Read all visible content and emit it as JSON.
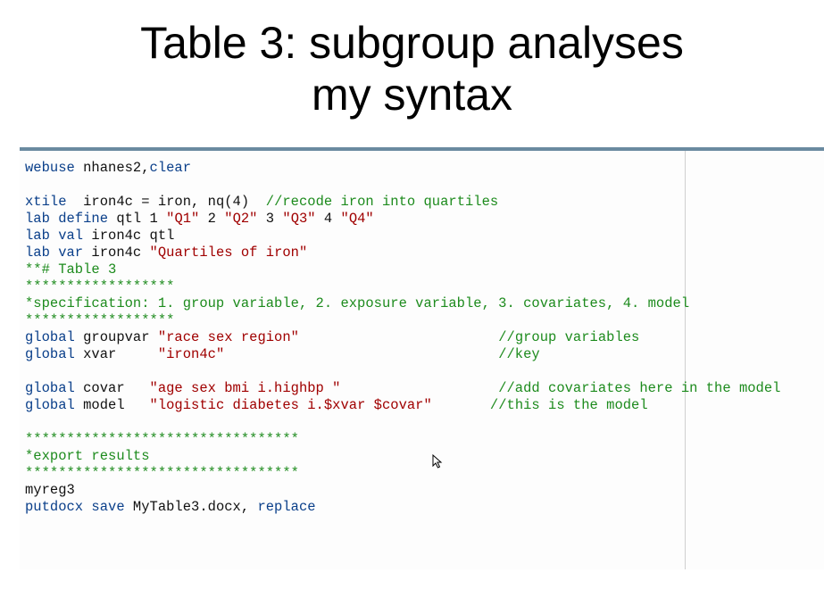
{
  "title_line1": "Table 3: subgroup analyses",
  "title_line2": "my syntax",
  "code": {
    "l1_cmd": "webuse",
    "l1_arg": " nhanes2,",
    "l1_opt": "clear",
    "l2_cmd": "xtile",
    "l2_arg": "  iron4c = iron, nq(4)  ",
    "l2_com": "//recode iron into quartiles",
    "l3_cmd": "lab define",
    "l3_a1": " qtl 1 ",
    "l3_s1": "\"Q1\"",
    "l3_a2": " 2 ",
    "l3_s2": "\"Q2\"",
    "l3_a3": " 3 ",
    "l3_s3": "\"Q3\"",
    "l3_a4": " 4 ",
    "l3_s4": "\"Q4\"",
    "l4_cmd": "lab val",
    "l4_arg": " iron4c qtl",
    "l5_cmd": "lab var",
    "l5_arg": " iron4c ",
    "l5_str": "\"Quartiles of iron\"",
    "l6": "**# Table 3",
    "l7": "******************",
    "l8": "*specification: 1. group variable, 2. exposure variable, 3. covariates, 4. model",
    "l9": "******************",
    "l10_cmd": "global",
    "l10_arg": " groupvar ",
    "l10_str": "\"race sex region\"",
    "l10_pad": "                        ",
    "l10_com": "//group variables",
    "l11_cmd": "global",
    "l11_arg": " xvar     ",
    "l11_str": "\"iron4c\"",
    "l11_pad": "                                 ",
    "l11_com": "//key",
    "l12_cmd": "global",
    "l12_arg": " covar   ",
    "l12_str": "\"age sex bmi i.highbp \"",
    "l12_pad": "                   ",
    "l12_com": "//add covariates here in the model",
    "l13_cmd": "global",
    "l13_arg": " model   ",
    "l13_str": "\"logistic diabetes i.$xvar $covar\"",
    "l13_pad": "       ",
    "l13_com": "//this is the model",
    "l14": "*********************************",
    "l15": "*export results",
    "l16": "*********************************",
    "l17": "myreg3",
    "l18_cmd": "putdocx save",
    "l18_arg": " MyTable3.docx, ",
    "l18_opt": "replace"
  }
}
